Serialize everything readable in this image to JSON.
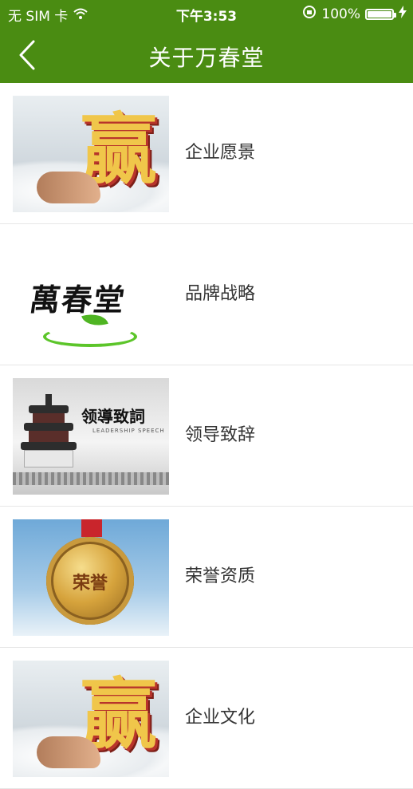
{
  "status_bar": {
    "carrier": "无 SIM 卡",
    "time": "下午3:53",
    "battery_percent": "100%",
    "battery_level": 1.0
  },
  "nav": {
    "title": "关于万春堂"
  },
  "logo_text": "萬春堂",
  "leadership_text": "领導致詞",
  "leadership_subtext": "LEADERSHIP SPEECH",
  "medal_text": "荣誉",
  "win_text": "赢",
  "list": {
    "items": [
      {
        "label": "企业愿景"
      },
      {
        "label": "品牌战略"
      },
      {
        "label": "领导致辞"
      },
      {
        "label": "荣誉资质"
      },
      {
        "label": "企业文化"
      }
    ]
  },
  "colors": {
    "brand_green": "#4a8c12",
    "divider": "#e6e6e6",
    "text": "#333333"
  }
}
